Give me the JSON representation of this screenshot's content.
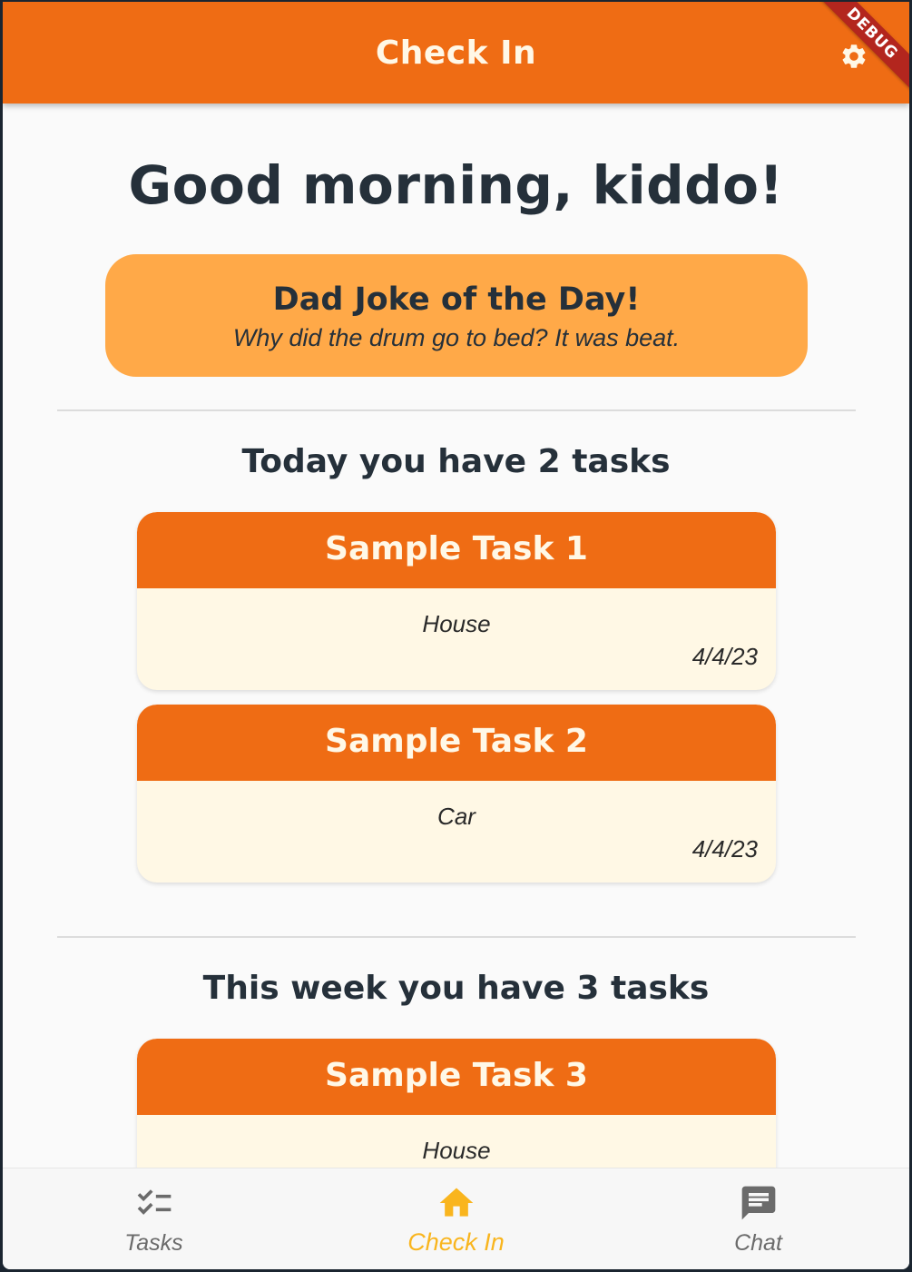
{
  "app_bar": {
    "title": "Check In",
    "debug_banner": "DEBUG",
    "settings_icon": "gear-icon"
  },
  "greeting": "Good morning, kiddo!",
  "joke": {
    "title": "Dad Joke of the Day!",
    "text": "Why did the drum go to bed? It was beat."
  },
  "today": {
    "heading": "Today you have 2 tasks",
    "tasks": [
      {
        "title": "Sample Task 1",
        "category": "House",
        "date": "4/4/23"
      },
      {
        "title": "Sample Task 2",
        "category": "Car",
        "date": "4/4/23"
      }
    ]
  },
  "week": {
    "heading": "This week you have 3 tasks",
    "tasks": [
      {
        "title": "Sample Task 3",
        "category": "House",
        "date": ""
      }
    ]
  },
  "bottom_nav": {
    "items": [
      {
        "label": "Tasks",
        "icon": "checklist-icon",
        "active": false
      },
      {
        "label": "Check In",
        "icon": "home-icon",
        "active": true
      },
      {
        "label": "Chat",
        "icon": "chat-icon",
        "active": false
      }
    ]
  },
  "colors": {
    "primary": "#ef6c14",
    "accent_card": "#ffa948",
    "task_body": "#fff8e5",
    "active_nav": "#f9b51e",
    "text_dark": "#25303a"
  }
}
